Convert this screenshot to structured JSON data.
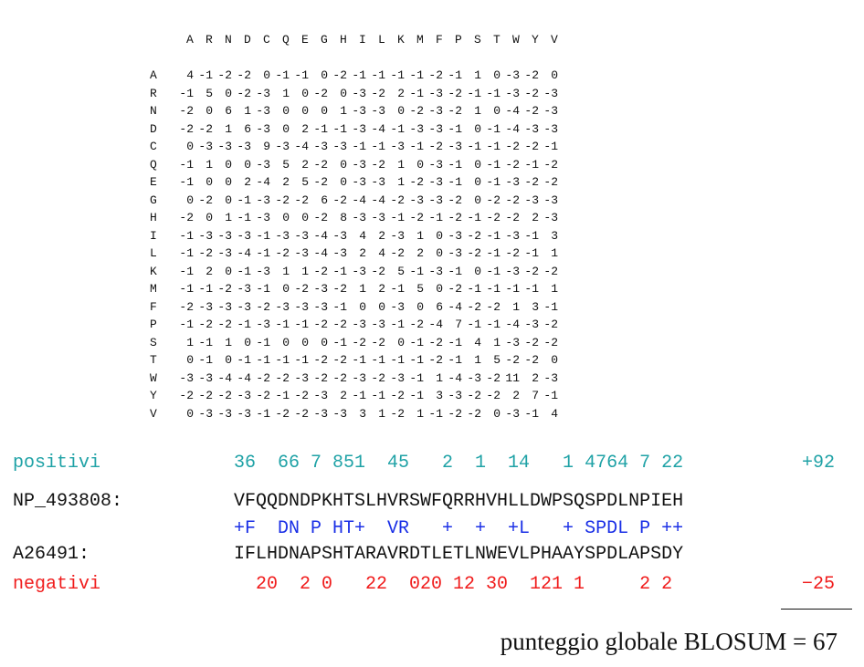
{
  "matrix": {
    "column_headers": [
      "A",
      "R",
      "N",
      "D",
      "C",
      "Q",
      "E",
      "G",
      "H",
      "I",
      "L",
      "K",
      "M",
      "F",
      "P",
      "S",
      "T",
      "W",
      "Y",
      "V"
    ],
    "row_headers": [
      "A",
      "R",
      "N",
      "D",
      "C",
      "Q",
      "E",
      "G",
      "H",
      "I",
      "L",
      "K",
      "M",
      "F",
      "P",
      "S",
      "T",
      "W",
      "Y",
      "V"
    ],
    "values": [
      [
        4,
        -1,
        -2,
        -2,
        0,
        -1,
        -1,
        0,
        -2,
        -1,
        -1,
        -1,
        -1,
        -2,
        -1,
        1,
        0,
        -3,
        -2,
        0
      ],
      [
        -1,
        5,
        0,
        -2,
        -3,
        1,
        0,
        -2,
        0,
        -3,
        -2,
        2,
        -1,
        -3,
        -2,
        -1,
        -1,
        -3,
        -2,
        -3
      ],
      [
        -2,
        0,
        6,
        1,
        -3,
        0,
        0,
        0,
        1,
        -3,
        -3,
        0,
        -2,
        -3,
        -2,
        1,
        0,
        -4,
        -2,
        -3
      ],
      [
        -2,
        -2,
        1,
        6,
        -3,
        0,
        2,
        -1,
        -1,
        -3,
        -4,
        -1,
        -3,
        -3,
        -1,
        0,
        -1,
        -4,
        -3,
        -3
      ],
      [
        0,
        -3,
        -3,
        -3,
        9,
        -3,
        -4,
        -3,
        -3,
        -1,
        -1,
        -3,
        -1,
        -2,
        -3,
        -1,
        -1,
        -2,
        -2,
        -1
      ],
      [
        -1,
        1,
        0,
        0,
        -3,
        5,
        2,
        -2,
        0,
        -3,
        -2,
        1,
        0,
        -3,
        -1,
        0,
        -1,
        -2,
        -1,
        -2
      ],
      [
        -1,
        0,
        0,
        2,
        -4,
        2,
        5,
        -2,
        0,
        -3,
        -3,
        1,
        -2,
        -3,
        -1,
        0,
        -1,
        -3,
        -2,
        -2
      ],
      [
        0,
        -2,
        0,
        -1,
        -3,
        -2,
        -2,
        6,
        -2,
        -4,
        -4,
        -2,
        -3,
        -3,
        -2,
        0,
        -2,
        -2,
        -3,
        -3
      ],
      [
        -2,
        0,
        1,
        -1,
        -3,
        0,
        0,
        -2,
        8,
        -3,
        -3,
        -1,
        -2,
        -1,
        -2,
        -1,
        -2,
        -2,
        2,
        -3
      ],
      [
        -1,
        -3,
        -3,
        -3,
        -1,
        -3,
        -3,
        -4,
        -3,
        4,
        2,
        -3,
        1,
        0,
        -3,
        -2,
        -1,
        -3,
        -1,
        3
      ],
      [
        -1,
        -2,
        -3,
        -4,
        -1,
        -2,
        -3,
        -4,
        -3,
        2,
        4,
        -2,
        2,
        0,
        -3,
        -2,
        -1,
        -2,
        -1,
        1
      ],
      [
        -1,
        2,
        0,
        -1,
        -3,
        1,
        1,
        -2,
        -1,
        -3,
        -2,
        5,
        -1,
        -3,
        -1,
        0,
        -1,
        -3,
        -2,
        -2
      ],
      [
        -1,
        -1,
        -2,
        -3,
        -1,
        0,
        -2,
        -3,
        -2,
        1,
        2,
        -1,
        5,
        0,
        -2,
        -1,
        -1,
        -1,
        -1,
        1
      ],
      [
        -2,
        -3,
        -3,
        -3,
        -2,
        -3,
        -3,
        -3,
        -1,
        0,
        0,
        -3,
        0,
        6,
        -4,
        -2,
        -2,
        1,
        3,
        -1
      ],
      [
        -1,
        -2,
        -2,
        -1,
        -3,
        -1,
        -1,
        -2,
        -2,
        -3,
        -3,
        -1,
        -2,
        -4,
        7,
        -1,
        -1,
        -4,
        -3,
        -2
      ],
      [
        1,
        -1,
        1,
        0,
        -1,
        0,
        0,
        0,
        -1,
        -2,
        -2,
        0,
        -1,
        -2,
        -1,
        4,
        1,
        -3,
        -2,
        -2
      ],
      [
        0,
        -1,
        0,
        -1,
        -1,
        -1,
        -1,
        -2,
        -2,
        -1,
        -1,
        -1,
        -1,
        -2,
        -1,
        1,
        5,
        -2,
        -2,
        0
      ],
      [
        -3,
        -3,
        -4,
        -4,
        -2,
        -2,
        -3,
        -2,
        -2,
        -3,
        -2,
        -3,
        -1,
        1,
        -4,
        -3,
        -2,
        11,
        2,
        -3
      ],
      [
        -2,
        -2,
        -2,
        -3,
        -2,
        -1,
        -2,
        -3,
        2,
        -1,
        -1,
        -2,
        -1,
        3,
        -3,
        -2,
        -2,
        2,
        7,
        -1
      ],
      [
        0,
        -3,
        -3,
        -3,
        -1,
        -2,
        -2,
        -3,
        -3,
        3,
        1,
        -2,
        1,
        -1,
        -2,
        -2,
        0,
        -3,
        -1,
        4
      ]
    ]
  },
  "alignment": {
    "positives": {
      "label": "positivi",
      "text": "36  66 7 851  45   2  1  14   1 4764 7 22",
      "total": "+92"
    },
    "query": {
      "label": "NP_493808:",
      "sequence": "VFQQDNDPKHTSLHVRSWFQRRHVHLLDWPSQSPDLNPIEH"
    },
    "match": {
      "text": "+F  DN P HT+  VR   +  +  +L   + SPDL P ++"
    },
    "subject": {
      "label": "A26491:",
      "sequence": "IFLHDNAPSHTARAVRDTLETLNWEVLPHAAYSPDLAPSDY"
    },
    "negatives": {
      "label": "negativi",
      "text": "  20  2 0   22  020 12 30  121 1     2 2",
      "total": "−25"
    }
  },
  "score": {
    "text": "punteggio globale BLOSUM = 67"
  }
}
